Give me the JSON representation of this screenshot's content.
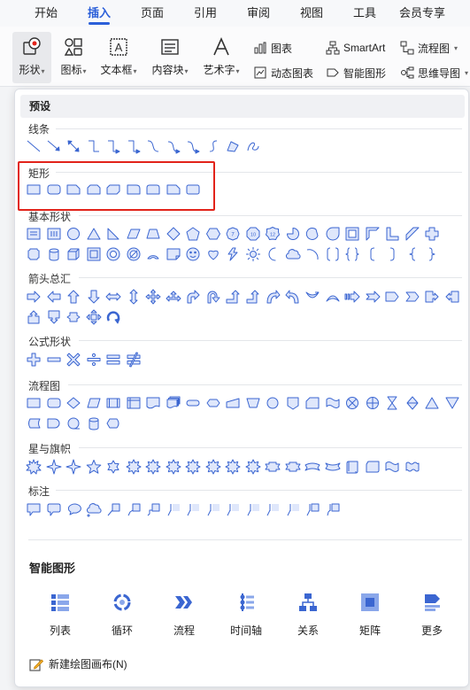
{
  "menubar": {
    "tabs": [
      {
        "label": "开始",
        "active": false
      },
      {
        "label": "插入",
        "active": true
      },
      {
        "label": "页面",
        "active": false
      },
      {
        "label": "引用",
        "active": false
      },
      {
        "label": "审阅",
        "active": false
      },
      {
        "label": "视图",
        "active": false
      },
      {
        "label": "工具",
        "active": false
      },
      {
        "label": "会员专享",
        "active": false
      }
    ]
  },
  "ribbon": {
    "shape_btn": "形状",
    "icon_btn": "图标",
    "textbox_btn": "文本框",
    "content_btn": "内容块",
    "wordart_btn": "艺术字",
    "chart_btn": "图表",
    "dynchart_btn": "动态图表",
    "smartart_btn": "SmartArt",
    "smartshape_btn": "智能图形",
    "flowchart_btn": "流程图",
    "mindmap_btn": "思维导图"
  },
  "panel": {
    "preset_label": "预设",
    "sections": {
      "lines": "线条",
      "rect": "矩形",
      "basic": "基本形状",
      "arrows": "箭头总汇",
      "formula": "公式形状",
      "flowchart": "流程图",
      "stars": "星与旗帜",
      "callouts": "标注"
    },
    "smart_title": "智能图形",
    "smart_items": [
      "列表",
      "循环",
      "流程",
      "时间轴",
      "关系",
      "矩阵",
      "更多"
    ],
    "new_canvas": "新建绘图画布(N)"
  },
  "colors": {
    "accent": "#2b5fd9",
    "shape_fill": "#dfe7fb",
    "shape_stroke": "#3b66d1",
    "highlight": "#e2231a"
  }
}
